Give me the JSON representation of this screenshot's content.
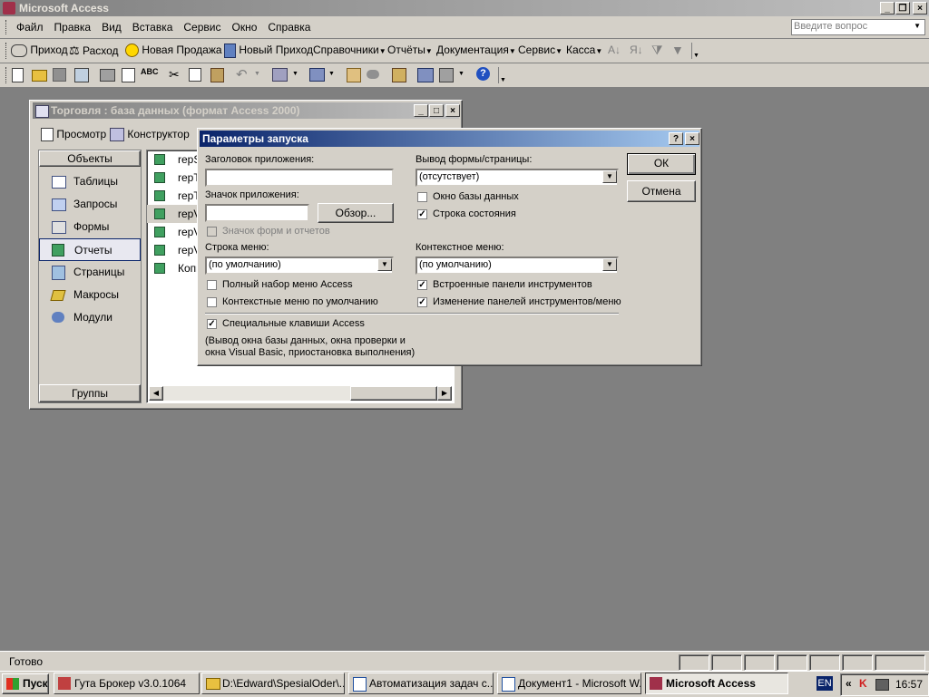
{
  "app": {
    "title": "Microsoft Access",
    "help_placeholder": "Введите вопрос"
  },
  "menu": [
    "Файл",
    "Правка",
    "Вид",
    "Вставка",
    "Сервис",
    "Окно",
    "Справка"
  ],
  "custom_toolbar": [
    {
      "label": "Приход",
      "icon": "handshake-icon"
    },
    {
      "label": "Расход",
      "icon": "scales-icon"
    },
    {
      "label": "Новая Продажа",
      "icon": "smiley-icon"
    },
    {
      "label": "Новый Приход",
      "icon": "calculator-icon"
    },
    {
      "label": "Справочники",
      "dropdown": true
    },
    {
      "label": "Отчёты",
      "dropdown": true
    },
    {
      "label": "Документация",
      "dropdown": true
    },
    {
      "label": "Сервис",
      "dropdown": true
    },
    {
      "label": "Касса",
      "dropdown": true
    }
  ],
  "db_window": {
    "title": "Торговля : база данных (формат Access 2000)",
    "toolbar": {
      "preview": "Просмотр",
      "design": "Конструктор"
    },
    "objects_header": "Объекты",
    "groups_label": "Группы",
    "objects": [
      {
        "label": "Таблицы",
        "icon": "table-icon"
      },
      {
        "label": "Запросы",
        "icon": "query-icon"
      },
      {
        "label": "Формы",
        "icon": "form-icon"
      },
      {
        "label": "Отчеты",
        "icon": "report-icon",
        "selected": true
      },
      {
        "label": "Страницы",
        "icon": "page-icon"
      },
      {
        "label": "Макросы",
        "icon": "macro-icon"
      },
      {
        "label": "Модули",
        "icon": "module-icon"
      }
    ],
    "items": [
      "repS",
      "repT",
      "repT",
      "repV",
      "repV",
      "repV",
      "Копи"
    ]
  },
  "dialog": {
    "title": "Параметры запуска",
    "app_title_label": "Заголовок приложения:",
    "app_title_value": "",
    "app_icon_label": "Значок приложения:",
    "app_icon_value": "",
    "browse_button": "Обзор...",
    "use_icon_label": "Значок форм и отчетов",
    "menubar_label": "Строка меню:",
    "menubar_value": "(по умолчанию)",
    "full_menus_label": "Полный набор меню Access",
    "default_shortcut_label": "Контекстные меню по умолчанию",
    "display_form_label": "Вывод формы/страницы:",
    "display_form_value": "(отсутствует)",
    "db_window_label": "Окно базы данных",
    "status_bar_label": "Строка состояния",
    "shortcut_menu_label": "Контекстное меню:",
    "shortcut_menu_value": "(по умолчанию)",
    "builtin_toolbars_label": "Встроенные панели инструментов",
    "toolbar_changes_label": "Изменение панелей инструментов/меню",
    "special_keys_label": "Специальные клавиши Access",
    "special_keys_note": "(Вывод окна базы данных, окна проверки и окна Visual Basic, приостановка выполнения)",
    "ok_button": "ОК",
    "cancel_button": "Отмена",
    "checks": {
      "use_icon": false,
      "full_menus": false,
      "default_shortcut": false,
      "db_window": false,
      "status_bar": true,
      "builtin_toolbars": true,
      "toolbar_changes": true,
      "special_keys": true
    }
  },
  "status_bar": {
    "text": "Готово"
  },
  "taskbar": {
    "start": "Пуск",
    "buttons": [
      "Гута Брокер v3.0.1064",
      "D:\\Edward\\SpesialOder\\...",
      "Автоматизация задач с...",
      "Документ1 - Microsoft W...",
      "Microsoft Access"
    ],
    "lang": "EN",
    "time": "16:57"
  },
  "colors": {
    "active_title": "#0a246a",
    "face": "#d4d0c8",
    "desktop": "#808080"
  }
}
